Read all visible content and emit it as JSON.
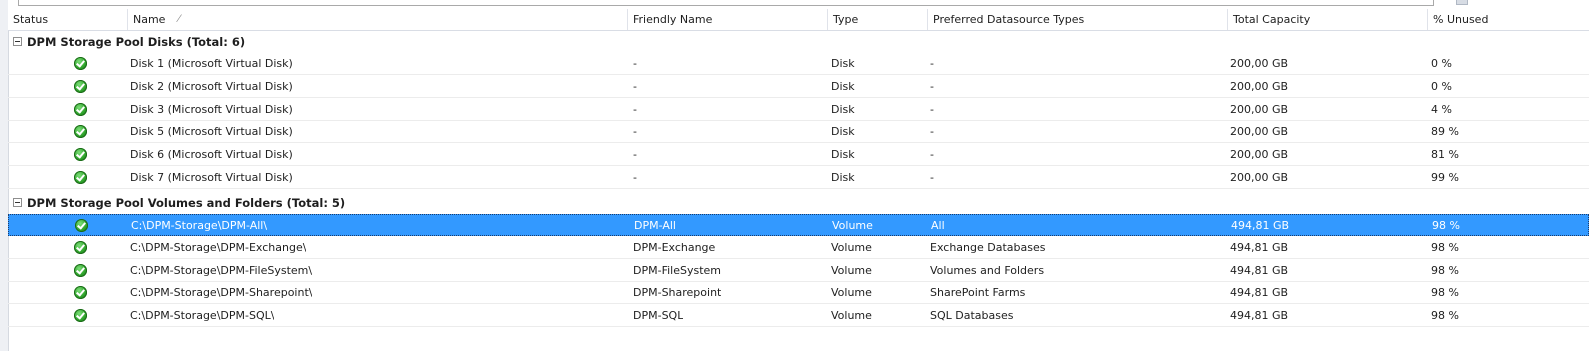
{
  "columns": [
    "Status",
    "Name",
    "Friendly Name",
    "Type",
    "Preferred Datasource Types",
    "Total Capacity",
    "% Unused"
  ],
  "sort_indicator": "/",
  "groups": [
    {
      "label": "DPM Storage Pool Disks (Total: 6)",
      "rows": [
        {
          "name": "Disk 1 (Microsoft Virtual Disk)",
          "friendly": "-",
          "type": "Disk",
          "pref": "-",
          "capacity": "200,00 GB",
          "unused": "0 %"
        },
        {
          "name": "Disk 2 (Microsoft Virtual Disk)",
          "friendly": "-",
          "type": "Disk",
          "pref": "-",
          "capacity": "200,00 GB",
          "unused": "0 %"
        },
        {
          "name": "Disk 3 (Microsoft Virtual Disk)",
          "friendly": "-",
          "type": "Disk",
          "pref": "-",
          "capacity": "200,00 GB",
          "unused": "4 %"
        },
        {
          "name": "Disk 5 (Microsoft Virtual Disk)",
          "friendly": "-",
          "type": "Disk",
          "pref": "-",
          "capacity": "200,00 GB",
          "unused": "89 %"
        },
        {
          "name": "Disk 6 (Microsoft Virtual Disk)",
          "friendly": "-",
          "type": "Disk",
          "pref": "-",
          "capacity": "200,00 GB",
          "unused": "81 %"
        },
        {
          "name": "Disk 7 (Microsoft Virtual Disk)",
          "friendly": "-",
          "type": "Disk",
          "pref": "-",
          "capacity": "200,00 GB",
          "unused": "99 %"
        }
      ]
    },
    {
      "label": "DPM Storage Pool Volumes and Folders (Total: 5)",
      "rows": [
        {
          "name": "C:\\DPM-Storage\\DPM-All\\",
          "friendly": "DPM-All",
          "type": "Volume",
          "pref": "All",
          "capacity": "494,81 GB",
          "unused": "98 %",
          "selected": true
        },
        {
          "name": "C:\\DPM-Storage\\DPM-Exchange\\",
          "friendly": "DPM-Exchange",
          "type": "Volume",
          "pref": "Exchange Databases",
          "capacity": "494,81 GB",
          "unused": "98 %"
        },
        {
          "name": "C:\\DPM-Storage\\DPM-FileSystem\\",
          "friendly": "DPM-FileSystem",
          "type": "Volume",
          "pref": "Volumes and Folders",
          "capacity": "494,81 GB",
          "unused": "98 %"
        },
        {
          "name": "C:\\DPM-Storage\\DPM-Sharepoint\\",
          "friendly": "DPM-Sharepoint",
          "type": "Volume",
          "pref": "SharePoint Farms",
          "capacity": "494,81 GB",
          "unused": "98 %"
        },
        {
          "name": "C:\\DPM-Storage\\DPM-SQL\\",
          "friendly": "DPM-SQL",
          "type": "Volume",
          "pref": "SQL Databases",
          "capacity": "494,81 GB",
          "unused": "98 %"
        }
      ]
    }
  ]
}
